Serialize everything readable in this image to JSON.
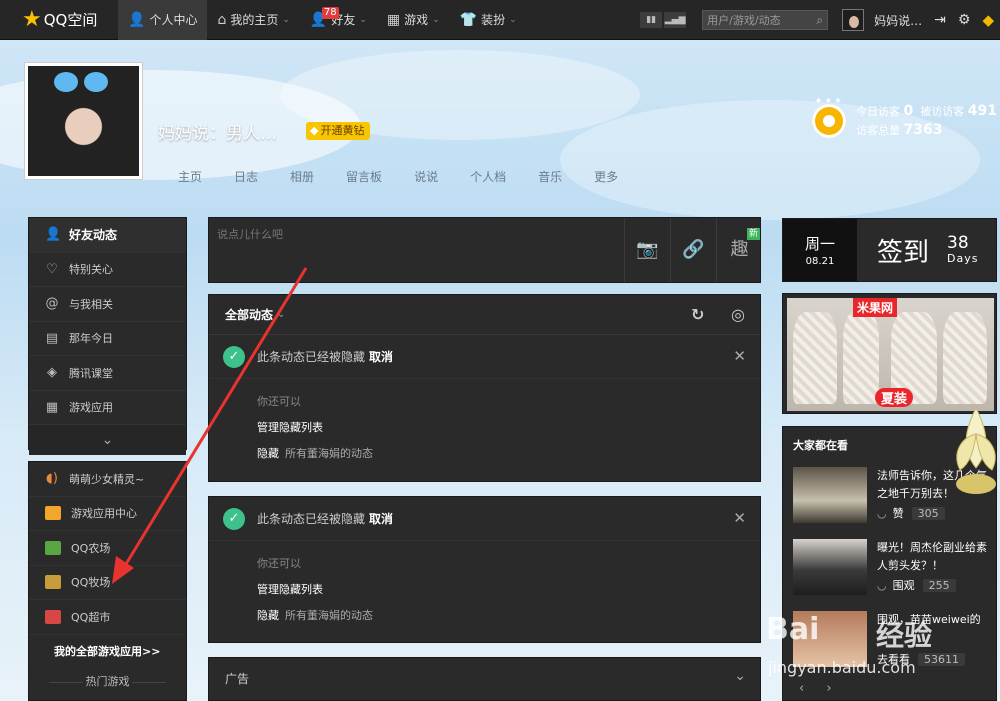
{
  "topbar": {
    "logo": "QQ空间",
    "nav": [
      {
        "label": "个人中心",
        "icon": "user-icon"
      },
      {
        "label": "我的主页",
        "icon": "home-icon"
      },
      {
        "label": "好友",
        "icon": "friends-icon",
        "badge": "78"
      },
      {
        "label": "游戏",
        "icon": "grid-icon"
      },
      {
        "label": "装扮",
        "icon": "shirt-icon"
      }
    ],
    "search_placeholder": "用户/游戏/动态",
    "username": "妈妈说…"
  },
  "profile": {
    "name": "妈妈说：男人…",
    "vip_button": "开通黄钻",
    "tabs": [
      "主页",
      "日志",
      "相册",
      "留言板",
      "说说",
      "个人档",
      "音乐",
      "更多"
    ],
    "visits": {
      "today_label": "今日访客",
      "today": "0",
      "total_visitor_label": "被访访客",
      "total_visitor": "491",
      "total_label": "访客总量",
      "total": "7363"
    }
  },
  "left_nav": {
    "items": [
      {
        "label": "好友动态",
        "icon": "user-icon"
      },
      {
        "label": "特别关心",
        "icon": "heart-icon"
      },
      {
        "label": "与我相关",
        "icon": "at-icon"
      },
      {
        "label": "那年今日",
        "icon": "calendar-icon"
      },
      {
        "label": "腾讯课堂",
        "icon": "graduation-icon"
      },
      {
        "label": "游戏应用",
        "icon": "apps-icon"
      }
    ],
    "more_icon": "chevron-down-icon"
  },
  "left_apps": {
    "items": [
      {
        "label": "萌萌少女精灵~",
        "color": "#e88a3c"
      },
      {
        "label": "游戏应用中心",
        "color": "#f2a72a"
      },
      {
        "label": "QQ农场",
        "color": "#5aa640"
      },
      {
        "label": "QQ牧场",
        "color": "#c99c3a"
      },
      {
        "label": "QQ超市",
        "color": "#d94646"
      }
    ],
    "all_games": "我的全部游戏应用>>",
    "hot_games": "热门游戏"
  },
  "composer": {
    "placeholder": "说点儿什么吧",
    "new_tag": "新",
    "quiz_label": "趣"
  },
  "feed": {
    "title": "全部动态",
    "hidden_cards": [
      {
        "message": "此条动态已经被隐藏",
        "cancel": "取消",
        "you_can": "你还可以",
        "manage": "管理隐藏列表",
        "hide": "隐藏",
        "hide_desc": "所有董海娟的动态"
      },
      {
        "message": "此条动态已经被隐藏",
        "cancel": "取消",
        "you_can": "你还可以",
        "manage": "管理隐藏列表",
        "hide": "隐藏",
        "hide_desc": "所有董海娟的动态"
      }
    ],
    "ad_title": "广告"
  },
  "checkin": {
    "weekday": "周一",
    "date": "08.21",
    "label": "签到",
    "count": "38",
    "unit": "Days"
  },
  "ad": {
    "brand": "米果网",
    "tag": "夏装"
  },
  "hot": {
    "title": "大家都在看",
    "items": [
      {
        "text": "法师告诉你，这几个气之地千万别去！",
        "action": "赞",
        "count": "305"
      },
      {
        "text": "曝光！周杰伦副业给素人剪头发？！",
        "action": "围观",
        "count": "255"
      },
      {
        "text": "围观，苗苗weiwei的",
        "action": "去看看",
        "count": "53611"
      }
    ]
  },
  "watermark": {
    "brand": "Bai",
    "brand2": "经验",
    "url": "jingyan.baidu.com"
  }
}
